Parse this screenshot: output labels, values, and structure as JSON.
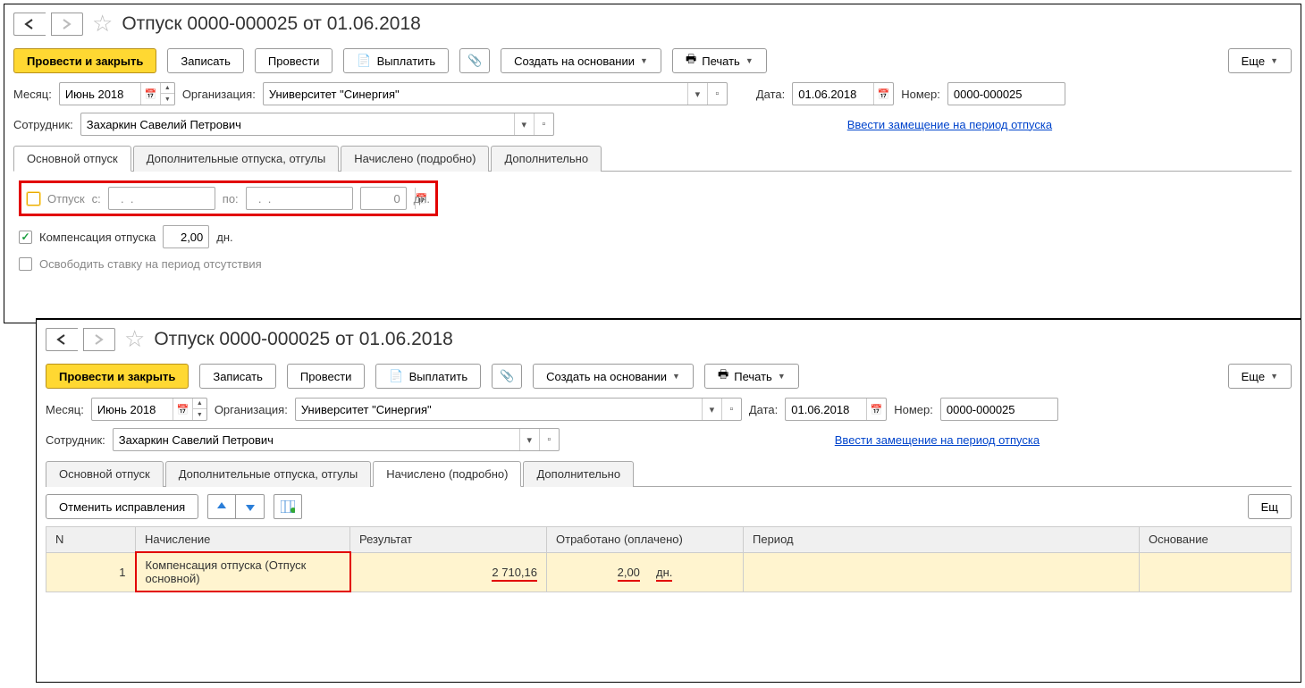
{
  "window_title": "Отпуск 0000-000025 от 01.06.2018",
  "toolbar": {
    "primary": "Провести и закрыть",
    "write": "Записать",
    "post": "Провести",
    "pay": "Выплатить",
    "create_based": "Создать на основании",
    "print": "Печать",
    "more": "Еще"
  },
  "form": {
    "month_lbl": "Месяц:",
    "month_val": "Июнь 2018",
    "org_lbl": "Организация:",
    "org_val": "Университет \"Синергия\"",
    "date_lbl": "Дата:",
    "date_val": "01.06.2018",
    "number_lbl": "Номер:",
    "number_val": "0000-000025",
    "emp_lbl": "Сотрудник:",
    "emp_val": "Захаркин Савелий Петрович",
    "link": "Ввести замещение на период отпуска"
  },
  "tabs": {
    "t1": "Основной отпуск",
    "t2": "Дополнительные отпуска, отгулы",
    "t3": "Начислено (подробно)",
    "t4": "Дополнительно"
  },
  "main_tab": {
    "vacation_chk": "Отпуск",
    "from": "с:",
    "to": "по:",
    "date_placeholder": "  .  .    ",
    "days_zero": "0",
    "days_unit": "дн.",
    "comp_chk": "Компенсация отпуска",
    "comp_val": "2,00",
    "release_chk": "Освободить ставку на период отсутствия"
  },
  "detail": {
    "cancel_fix": "Отменить исправления",
    "more2": "Ещ",
    "cols": {
      "n": "N",
      "accrual": "Начисление",
      "result": "Результат",
      "worked": "Отработано (оплачено)",
      "period": "Период",
      "basis": "Основание"
    },
    "row": {
      "n": "1",
      "accrual": "Компенсация отпуска (Отпуск основной)",
      "result": "2 710,16",
      "worked_val": "2,00",
      "worked_unit": "дн."
    }
  }
}
